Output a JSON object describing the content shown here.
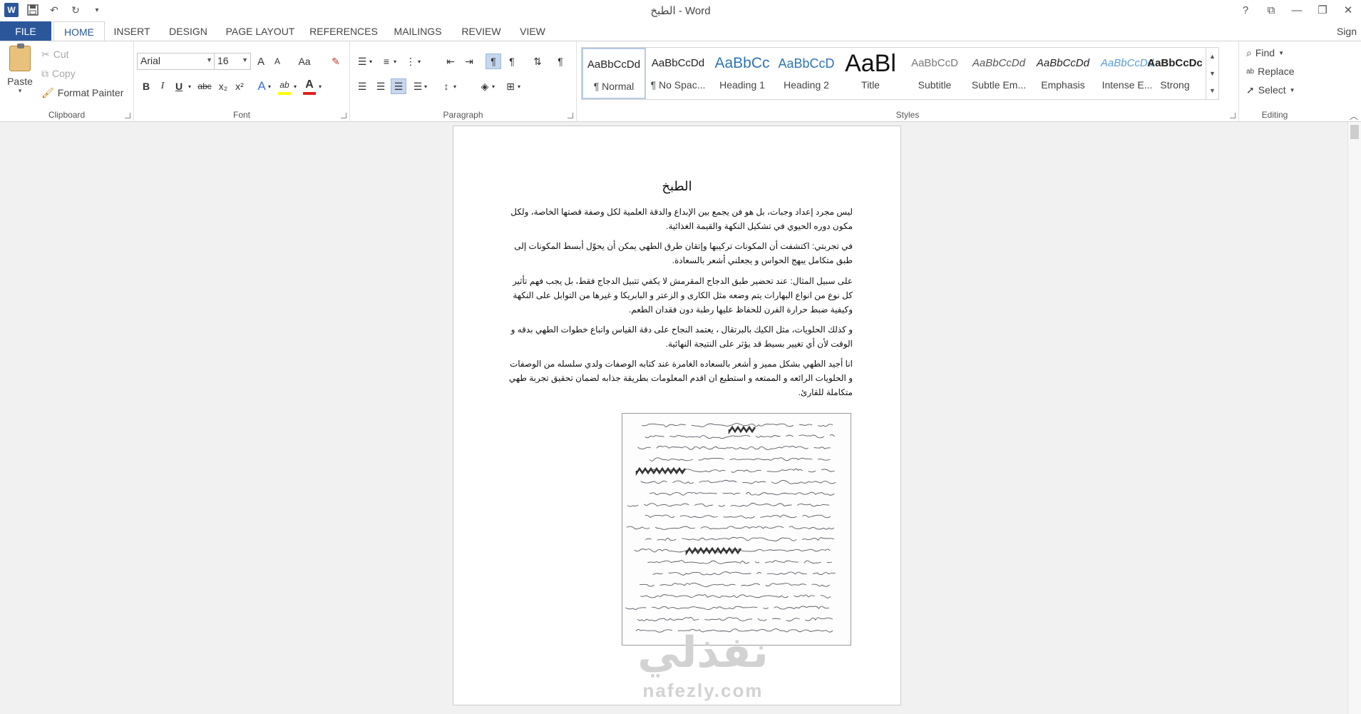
{
  "app": {
    "title": "الطبخ - Word",
    "sign_in": "Sign"
  },
  "qat": {
    "icons": [
      "word-logo",
      "save-icon",
      "undo-icon",
      "redo-icon",
      "customize-icon"
    ]
  },
  "tabs": [
    "FILE",
    "HOME",
    "INSERT",
    "DESIGN",
    "PAGE LAYOUT",
    "REFERENCES",
    "MAILINGS",
    "REVIEW",
    "VIEW"
  ],
  "clipboard": {
    "paste": "Paste",
    "cut": "Cut",
    "copy": "Copy",
    "format_painter": "Format Painter",
    "label": "Clipboard"
  },
  "font": {
    "family": "Arial",
    "size": "16",
    "label": "Font",
    "grow": "A",
    "shrink": "A",
    "change_case": "Aa",
    "bold": "B",
    "italic": "I",
    "underline": "U",
    "strike": "abc",
    "subscript": "x₂",
    "superscript": "x²",
    "text_effects": "A",
    "highlight": "ab",
    "font_color": "A",
    "highlight_color": "#ffff00",
    "font_color_value": "#e02020"
  },
  "paragraph": {
    "label": "Paragraph",
    "pilcrow": "¶"
  },
  "styles": {
    "label": "Styles",
    "items": [
      {
        "preview": "AaBbCcDd",
        "name": "¶ Normal"
      },
      {
        "preview": "AaBbCcDd",
        "name": "¶ No Spac..."
      },
      {
        "preview": "AaBbCc",
        "name": "Heading 1"
      },
      {
        "preview": "AaBbCcD",
        "name": "Heading 2"
      },
      {
        "preview": "AaBl",
        "name": "Title"
      },
      {
        "preview": "AaBbCcD",
        "name": "Subtitle"
      },
      {
        "preview": "AaBbCcDd",
        "name": "Subtle Em..."
      },
      {
        "preview": "AaBbCcDd",
        "name": "Emphasis"
      },
      {
        "preview": "AaBbCcDd",
        "name": "Intense E..."
      },
      {
        "preview": "AaBbCcDc",
        "name": "Strong"
      }
    ]
  },
  "editing": {
    "find": "Find",
    "replace": "Replace",
    "select": "Select",
    "label": "Editing"
  },
  "document": {
    "title": "الطبخ",
    "paragraphs": [
      "ليس مجرد إعداد وجبات، بل هو فن يجمع بين الإبداع والدقة العلمية  لكل وصفة قصتها الخاصة، ولكل مكون دوره الحيوي في تشكيل النكهة والقيمة الغذائية.",
      " في تجربتي: اكتشفت أن المكونات  تركيبها  وإتقان طرق الطهي يمكن أن يحوّل أبسط المكونات إلى طبق متكامل يبهج الحواس و يجعلني أشعر بالسعادة.",
      "على سبيل المثال: عند تحضير طبق الدجاج المقرمش لا يكفي تتبيل الدجاج فقط، بل يجب فهم تأثير كل نوع من انواع البهارات يتم وضعه مثل الكارى و الزعتر و البابريكا و غيرها من التوابل على النكهة وكيفية ضبط حرارة الفرن للحفاظ عليها رطبة دون فقدان الطعم.",
      "و كذلك  الحلويات، مثل الكيك بالبرتقال ، يعتمد النجاح على دقة القياس واتباع خطوات الطهي بدقه و الوقت  لأن أي تغيير بسيط قد يؤثر على النتيجة النهائية.",
      "انا أجيد الطهي بشكل مميز و أشعر بالسعاده الغامرة عند كتابه الوصفات ولدي سلسله من الوصفات و الحلويات الرائعه و الممتعه و استطيع ان اقدم المعلومات بطريقة جذابه لضمان تحقيق تجربة طهي متكاملة للقارئ."
    ],
    "watermark_ar": "نفذلي",
    "watermark_en": "nafezly.com"
  }
}
